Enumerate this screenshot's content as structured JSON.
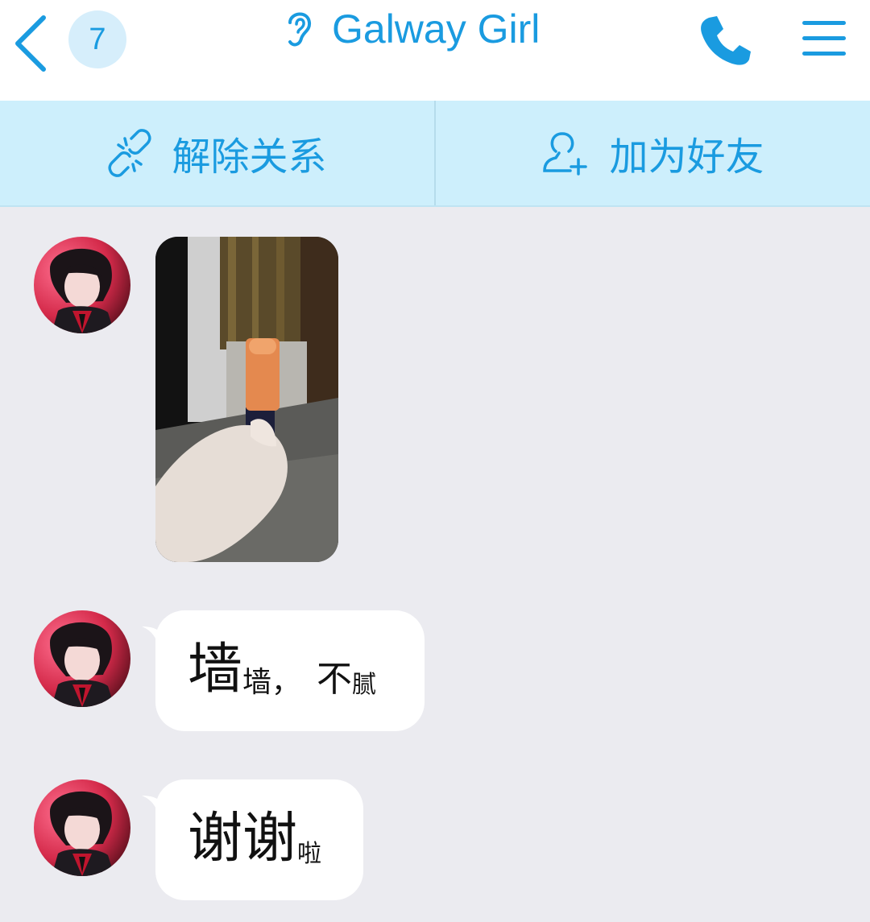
{
  "header": {
    "back_icon": "chevron-left-icon",
    "unread_count": "7",
    "title": "Galway Girl",
    "mode_icon": "ear-icon",
    "call_icon": "phone-icon",
    "menu_icon": "hamburger-menu-icon",
    "accent_color": "#1a9be0"
  },
  "actions": [
    {
      "label": "解除关系",
      "icon": "broken-link-icon"
    },
    {
      "label": "加为好友",
      "icon": "add-user-icon"
    }
  ],
  "messages": [
    {
      "type": "image",
      "sender": "contact",
      "icon": "photo-lipstick"
    },
    {
      "type": "text",
      "sender": "contact",
      "parts": [
        "墙",
        "墙，",
        "不",
        "腻"
      ]
    },
    {
      "type": "text",
      "sender": "contact",
      "parts": [
        "谢谢",
        "啦"
      ]
    }
  ]
}
